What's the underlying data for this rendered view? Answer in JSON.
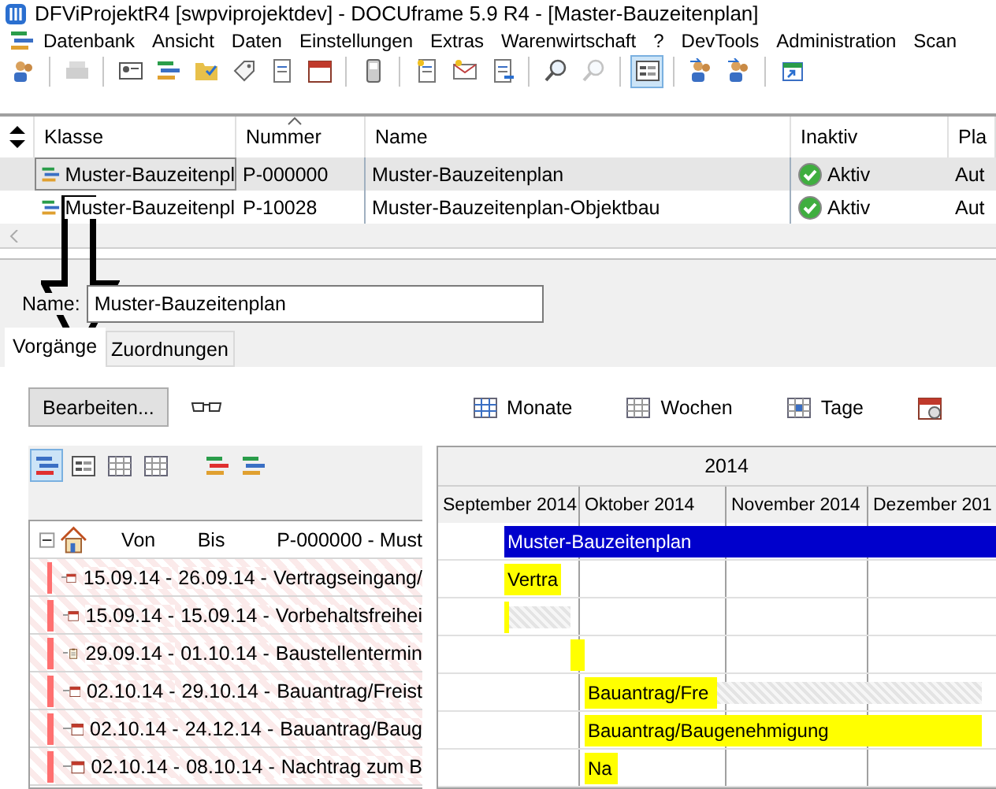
{
  "window": {
    "title": "DFViProjektR4 [swpviprojektdev] - DOCUframe 5.9 R4 - [Master-Bauzeitenplan]"
  },
  "menu": [
    "Datenbank",
    "Ansicht",
    "Daten",
    "Einstellungen",
    "Extras",
    "Warenwirtschaft",
    "?",
    "DevTools",
    "Administration",
    "Scan"
  ],
  "toolbar": [
    {
      "kind": "users",
      "disabled": false,
      "selected": false
    },
    {
      "kind": "separator"
    },
    {
      "kind": "printer",
      "disabled": true,
      "selected": false
    },
    {
      "kind": "separator"
    },
    {
      "kind": "card",
      "disabled": false,
      "selected": false
    },
    {
      "kind": "bars",
      "disabled": false,
      "selected": false
    },
    {
      "kind": "folder",
      "disabled": false,
      "selected": false
    },
    {
      "kind": "tag",
      "disabled": false,
      "selected": false
    },
    {
      "kind": "documents",
      "disabled": false,
      "selected": false
    },
    {
      "kind": "calendar",
      "disabled": false,
      "selected": false
    },
    {
      "kind": "separator"
    },
    {
      "kind": "phone",
      "disabled": false,
      "selected": false
    },
    {
      "kind": "separator"
    },
    {
      "kind": "document",
      "disabled": false,
      "selected": false
    },
    {
      "kind": "envelope",
      "disabled": false,
      "selected": false
    },
    {
      "kind": "document-arrow",
      "disabled": false,
      "selected": false
    },
    {
      "kind": "separator"
    },
    {
      "kind": "search",
      "disabled": false,
      "selected": false
    },
    {
      "kind": "search",
      "disabled": true,
      "selected": false
    },
    {
      "kind": "separator"
    },
    {
      "kind": "form",
      "disabled": false,
      "selected": true
    },
    {
      "kind": "separator"
    },
    {
      "kind": "users-arrow",
      "disabled": false,
      "selected": false
    },
    {
      "kind": "users-document",
      "disabled": false,
      "selected": false
    },
    {
      "kind": "separator"
    },
    {
      "kind": "window-arrow",
      "disabled": false,
      "selected": false
    }
  ],
  "table": {
    "columns": [
      {
        "label": "Klasse",
        "sorted": false
      },
      {
        "label": "Nummer",
        "sorted": true
      },
      {
        "label": "Name",
        "sorted": false
      },
      {
        "label": "Inaktiv",
        "sorted": false
      },
      {
        "label": "Pla",
        "sorted": false
      }
    ],
    "rows": [
      {
        "selected": true,
        "cells": [
          "Muster-Bauzeitenpl",
          "P-000000",
          "Muster-Bauzeitenplan",
          "Aktiv",
          "Aut"
        ]
      },
      {
        "selected": false,
        "cells": [
          "Muster-Bauzeitenpl",
          "P-10028",
          "Muster-Bauzeitenplan-Objektbau",
          "Aktiv",
          "Aut"
        ]
      }
    ]
  },
  "name_field": {
    "label": "Name:",
    "value": "Muster-Bauzeitenplan"
  },
  "tabs": [
    {
      "label": "Vorgänge",
      "selected": true
    },
    {
      "label": "Zuordnungen",
      "selected": false
    }
  ],
  "edit_button": "Bearbeiten...",
  "view_buttons": [
    {
      "label": "Monate",
      "kind": "months"
    },
    {
      "label": "Wochen",
      "kind": "weeks"
    },
    {
      "label": "Tage",
      "kind": "days"
    },
    {
      "kind": "calendar-clock"
    }
  ],
  "tree_toolbar": [
    {
      "kind": "gantt",
      "selected": true
    },
    {
      "kind": "form",
      "selected": false
    },
    {
      "kind": "grid",
      "selected": false
    },
    {
      "kind": "grid",
      "selected": false
    },
    {
      "kind": "gap"
    },
    {
      "kind": "edit-bars",
      "selected": false
    },
    {
      "kind": "bars",
      "selected": false
    }
  ],
  "tree": {
    "header": {
      "von": "Von",
      "bis": "Bis",
      "title": "P-000000 - Must",
      "expanded": true
    },
    "rows": [
      {
        "kind": "calendar",
        "from": "15.09.14 -",
        "to": "26.09.14 -",
        "title": "Vertragseingang/"
      },
      {
        "kind": "calendar",
        "from": "15.09.14 -",
        "to": "15.09.14 -",
        "title": "Vorbehaltsfreihei"
      },
      {
        "kind": "clipboard",
        "from": "29.09.14 -",
        "to": "01.10.14 -",
        "title": "Baustellentermin"
      },
      {
        "kind": "calendar",
        "from": "02.10.14 -",
        "to": "29.10.14 -",
        "title": "Bauantrag/Freist"
      },
      {
        "kind": "calendar",
        "from": "02.10.14 -",
        "to": "24.12.14 -",
        "title": "Bauantrag/Baug"
      },
      {
        "kind": "calendar",
        "from": "02.10.14 -",
        "to": "08.10.14 -",
        "title": "Nachtrag zum B"
      }
    ]
  },
  "gantt": {
    "year": "2014",
    "months": [
      "September 2014",
      "Oktober 2014",
      "November 2014",
      "Dezember 201"
    ],
    "summary": {
      "label": "Muster-Bauzeitenplan"
    },
    "bars": [
      {
        "label": "Vertra",
        "slack": false
      },
      {
        "slack": true
      },
      {
        "slack": false
      },
      {
        "label": "Bauantrag/Fre",
        "slack": true
      },
      {
        "label": "Bauantrag/Baugenehmigung",
        "slack": false
      },
      {
        "label": "Na",
        "slack": false
      }
    ]
  }
}
